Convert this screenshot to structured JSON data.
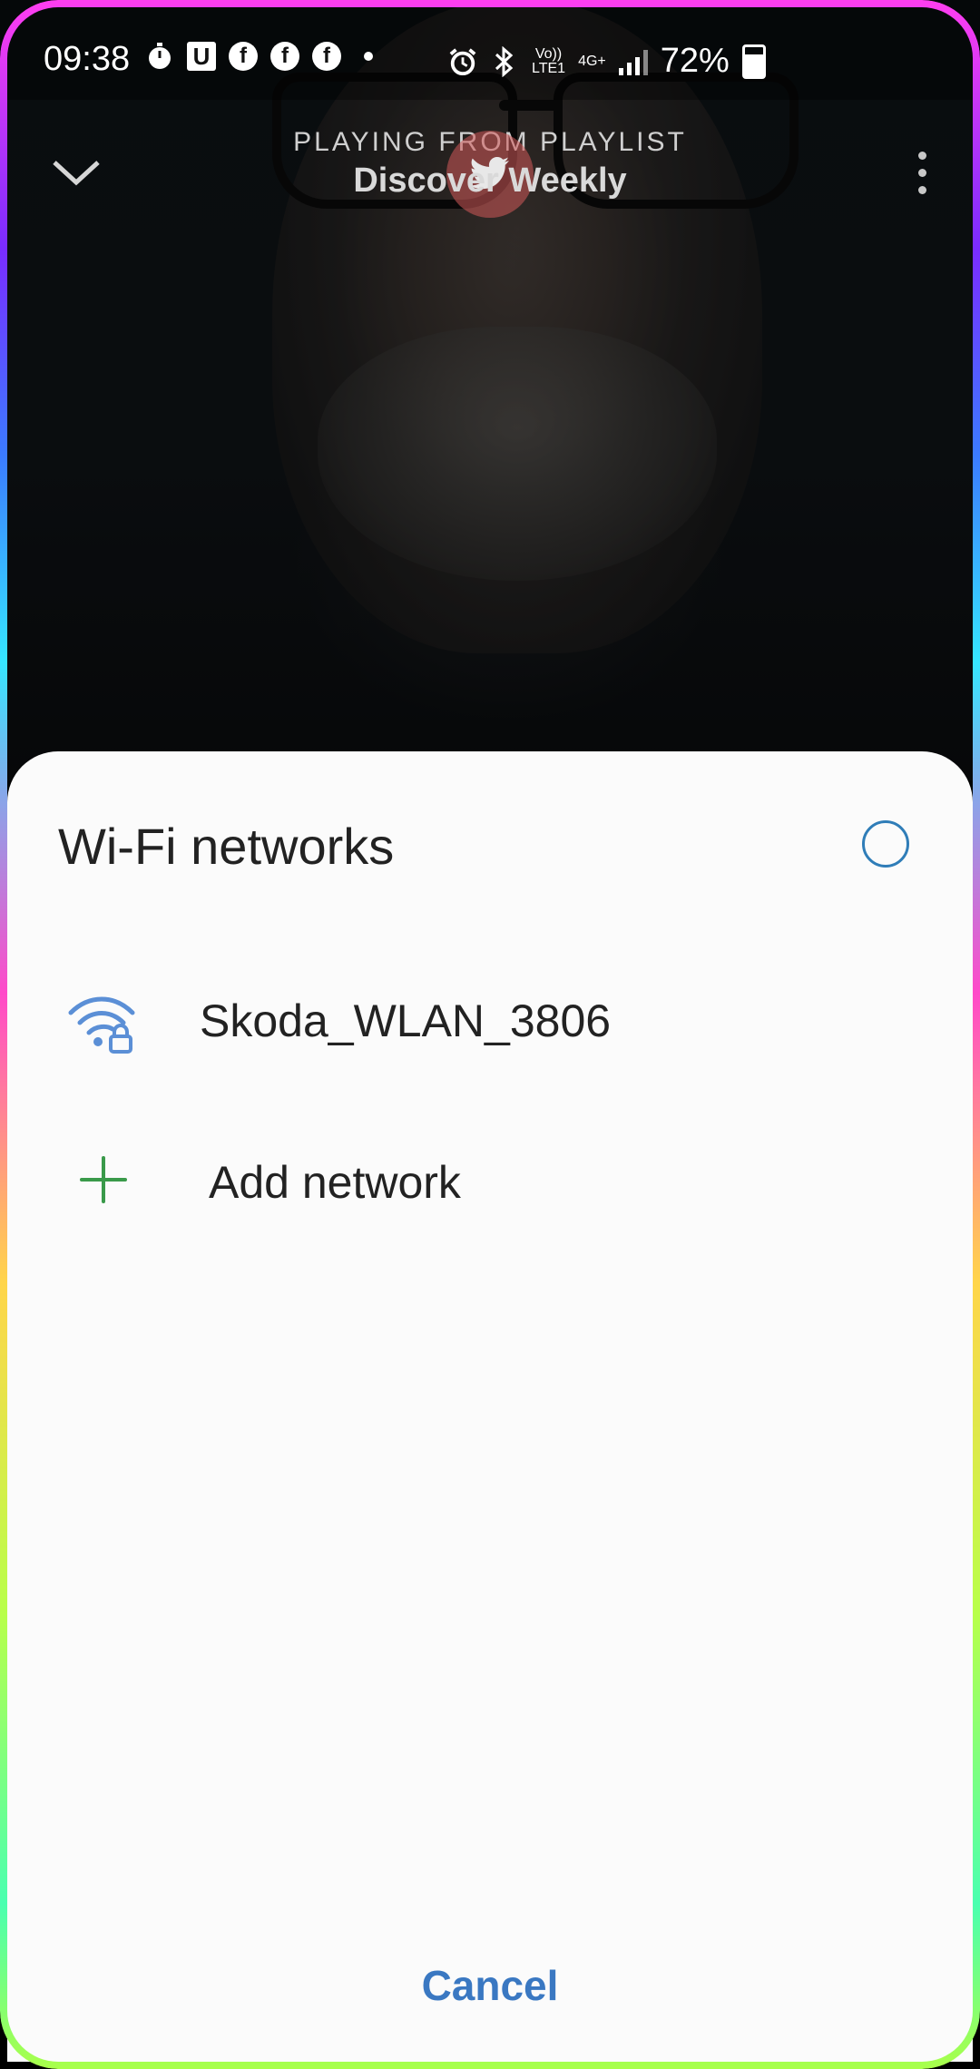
{
  "status_bar": {
    "time": "09:38",
    "notification_icons": [
      "timer-icon",
      "u-app-icon",
      "facebook-icon",
      "facebook-icon",
      "facebook-icon",
      "more-notifications-dot"
    ],
    "system_icons": [
      "alarm-icon",
      "bluetooth-icon",
      "volte-icon",
      "4g-icon",
      "signal-icon"
    ],
    "volte_label": "Vo))\nLTE1",
    "net_label": "4G+",
    "battery_percent": "72%",
    "u_label": "U",
    "fb_label": "f"
  },
  "player": {
    "playing_from": "PLAYING FROM PLAYLIST",
    "playlist_name": "Discover Weekly"
  },
  "sheet": {
    "title": "Wi-Fi networks",
    "networks": [
      {
        "name": "Skoda_WLAN_3806",
        "icon": "wifi-lock-icon",
        "secured": true
      }
    ],
    "add_network_label": "Add network",
    "cancel_label": "Cancel"
  },
  "colors": {
    "accent": "#3a78c2",
    "add_icon": "#3a9a4a",
    "spinner": "#2f7db8",
    "wifi_icon": "#5b8fd6"
  }
}
